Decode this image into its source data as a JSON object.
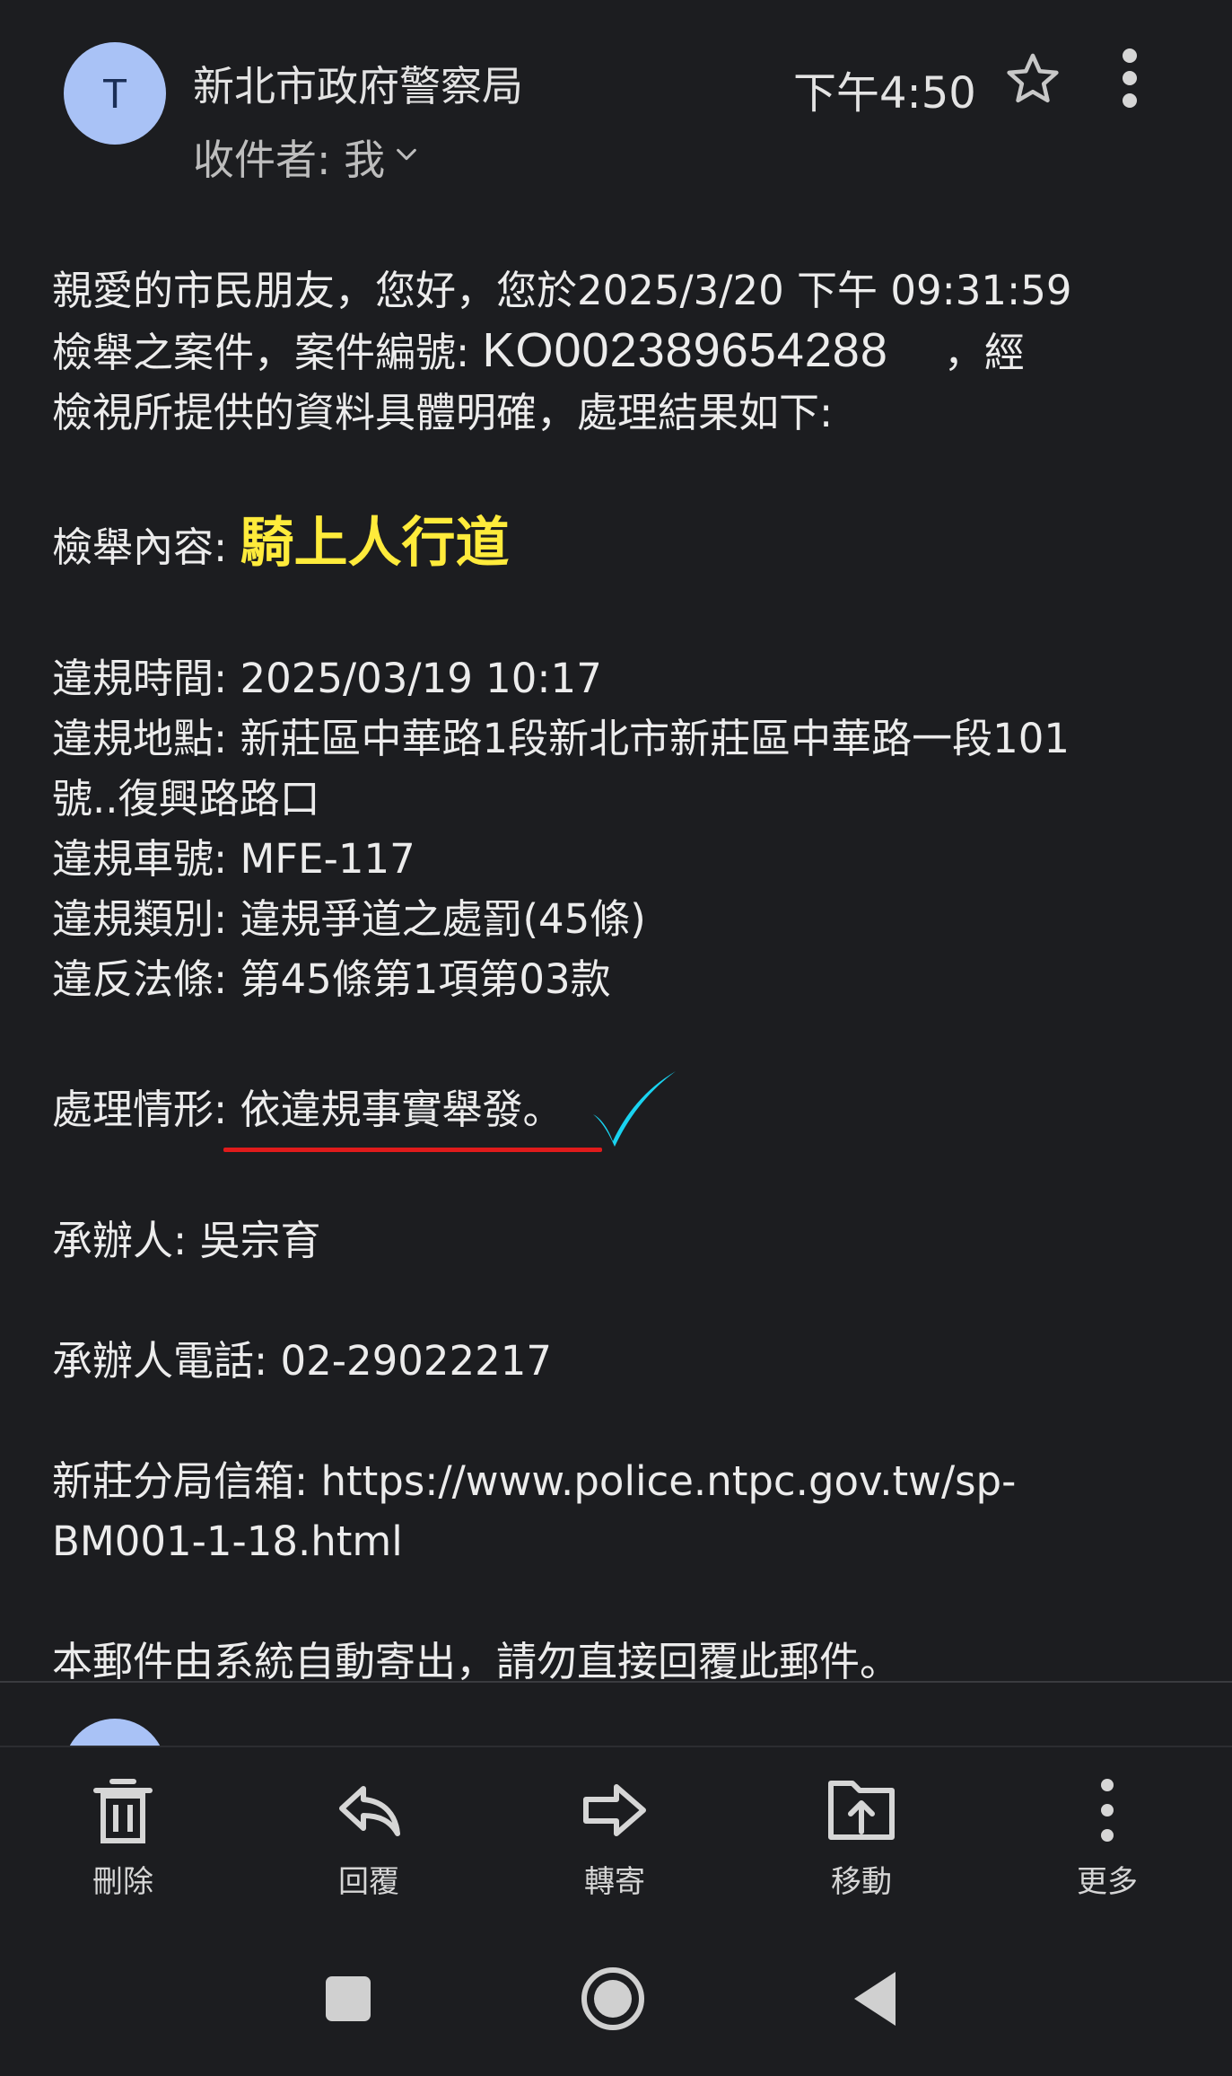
{
  "header": {
    "avatar_letter": "T",
    "sender": "新北市政府警察局",
    "recipient": "收件者: 我",
    "time": "下午4:50"
  },
  "email": {
    "greeting_1": "親愛的市民朋友，您好，您於2025/3/20 下午 09:31:59",
    "greeting_2a": "檢舉之案件，案件編號: ",
    "case_number": "KO002389654288",
    "greeting_2b": "，經",
    "greeting_3": "檢視所提供的資料具體明確，處理結果如下:",
    "report_label": "檢舉內容: ",
    "report_value": "騎上人行道",
    "violation_time_label": "違規時間: ",
    "violation_time": "2025/03/19 10:17",
    "violation_place_label": "違規地點: ",
    "violation_place_1": "新莊區中華路1段新北市新莊區中華路一段101",
    "violation_place_2": "號..復興路路口",
    "plate_label": "違規車號: ",
    "plate": "MFE-117",
    "category_label": "違規類別: ",
    "category": "違規爭道之處罰(45條)",
    "law_label": "違反法條: ",
    "law": "第45條第1項第03款",
    "status_label": "處理情形: ",
    "status": "依違規事實舉發。",
    "officer_label": "承辦人: ",
    "officer": "吳宗育",
    "phone_label": "承辦人電話: ",
    "phone": "02-29022217",
    "mailbox_label": "新莊分局信箱: ",
    "mailbox_url_1": "https://www.police.ntpc.gov.tw/sp-",
    "mailbox_url_2": "BM001-1-18.html",
    "footer": "本郵件由系統自動寄出，請勿直接回覆此郵件。"
  },
  "toolbar": {
    "delete": "刪除",
    "reply": "回覆",
    "forward": "轉寄",
    "move": "移動",
    "more": "更多"
  },
  "colors": {
    "background": "#1c1d20",
    "highlight": "#ffeb3b",
    "underline": "#e01b1b",
    "check": "#19d3f0",
    "avatar": "#a9c2f6"
  }
}
